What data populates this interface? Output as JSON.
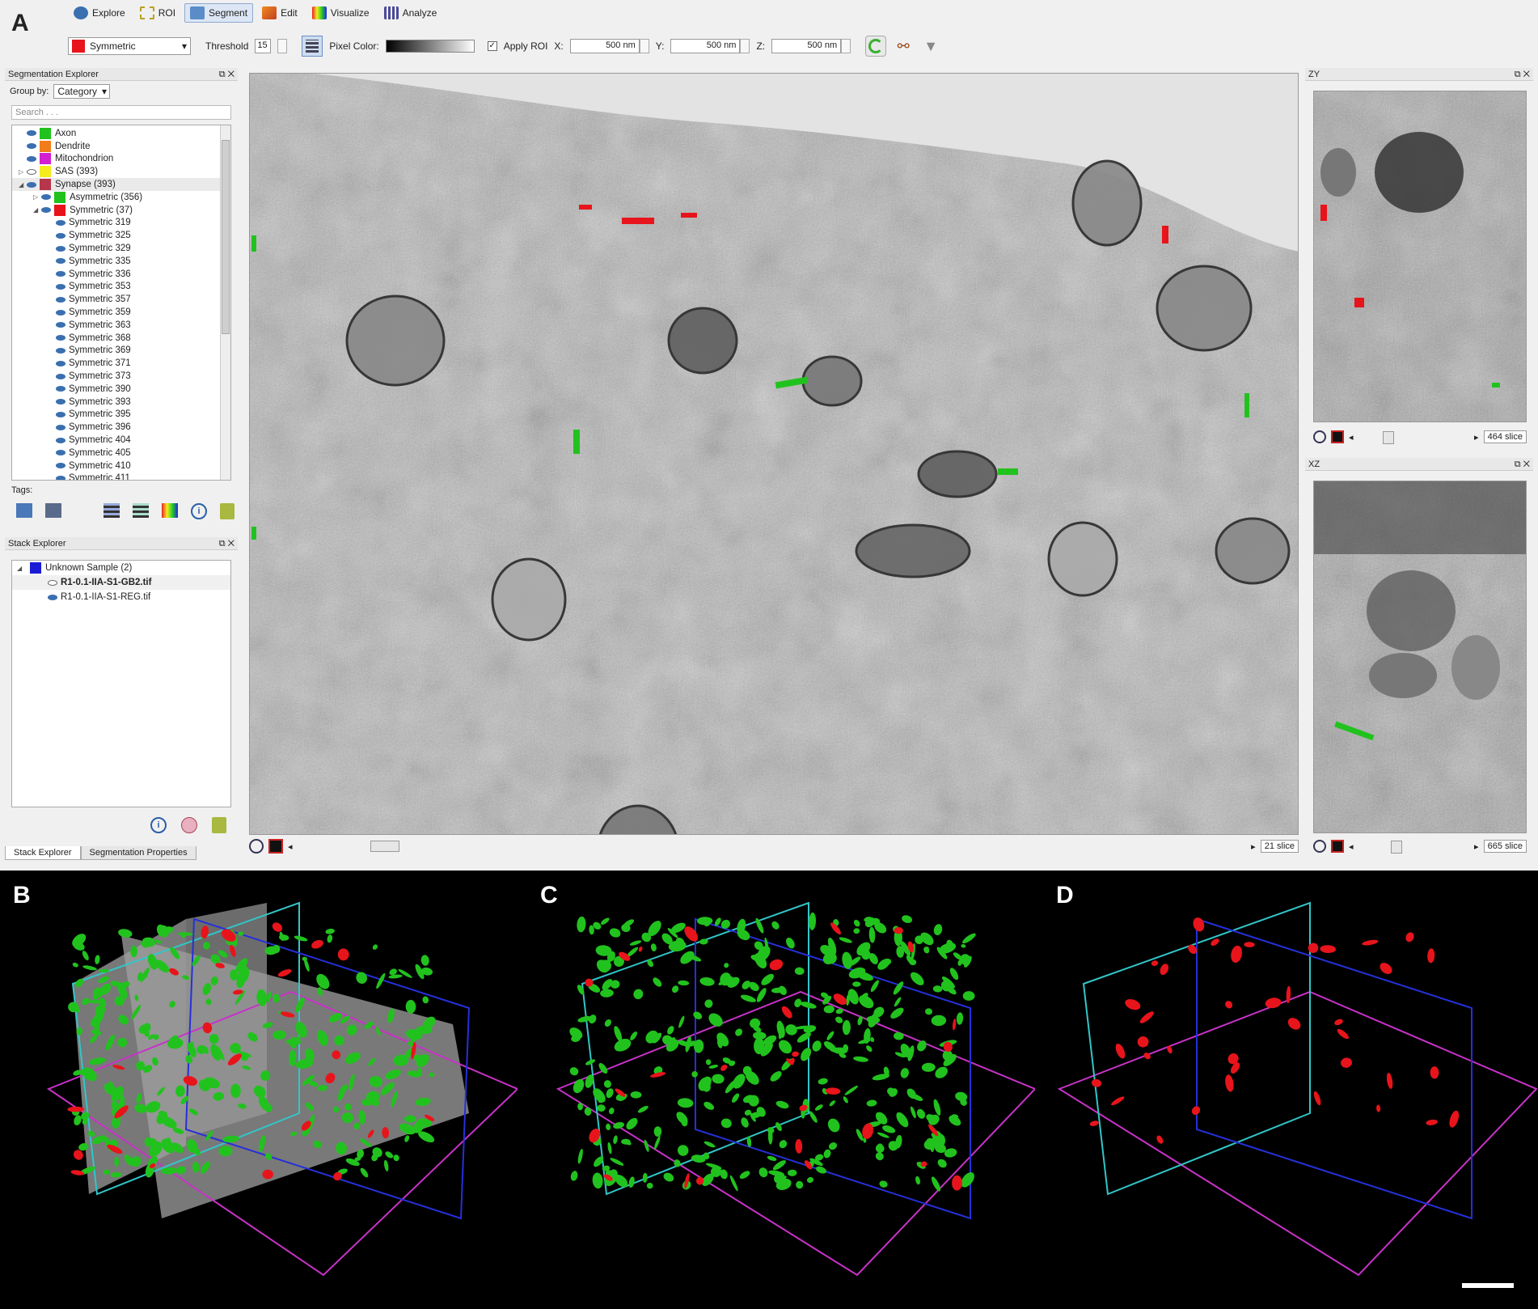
{
  "panels": {
    "a": "A",
    "b": "B",
    "c": "C",
    "d": "D"
  },
  "modes": [
    {
      "label": "Explore",
      "active": false
    },
    {
      "label": "ROI",
      "active": false
    },
    {
      "label": "Segment",
      "active": true
    },
    {
      "label": "Edit",
      "active": false
    },
    {
      "label": "Visualize",
      "active": false
    },
    {
      "label": "Analyze",
      "active": false
    }
  ],
  "toolbar": {
    "category_value": "Symmetric",
    "category_color": "#e8141b",
    "threshold_label": "Threshold",
    "threshold_value": "15",
    "pixel_color_label": "Pixel Color:",
    "apply_roi_label": "Apply ROI",
    "x_label": "X:",
    "x_value": "500 nm",
    "y_label": "Y:",
    "y_value": "500 nm",
    "z_label": "Z:",
    "z_value": "500 nm"
  },
  "seg_explorer": {
    "title": "Segmentation Explorer",
    "group_by_label": "Group by:",
    "group_by_value": "Category",
    "search_placeholder": "Search . . .",
    "items": [
      {
        "label": "Axon",
        "color": "#22c21e",
        "level": 0,
        "expander": ""
      },
      {
        "label": "Dendrite",
        "color": "#f07d1a",
        "level": 0,
        "expander": ""
      },
      {
        "label": "Mitochondrion",
        "color": "#d11fd1",
        "level": 0,
        "expander": ""
      },
      {
        "label": "SAS (393)",
        "color": "#f4ec1c",
        "level": 0,
        "expander": "▷"
      },
      {
        "label": "Synapse (393)",
        "color": "#b8364a",
        "level": 0,
        "expander": "◢"
      },
      {
        "label": "Asymmetric (356)",
        "color": "#22c21e",
        "level": 1,
        "expander": "▷"
      },
      {
        "label": "Symmetric (37)",
        "color": "#e8141b",
        "level": 1,
        "expander": "◢"
      },
      {
        "label": "Symmetric 319",
        "level": 2
      },
      {
        "label": "Symmetric 325",
        "level": 2
      },
      {
        "label": "Symmetric 329",
        "level": 2
      },
      {
        "label": "Symmetric 335",
        "level": 2
      },
      {
        "label": "Symmetric 336",
        "level": 2
      },
      {
        "label": "Symmetric 353",
        "level": 2
      },
      {
        "label": "Symmetric 357",
        "level": 2
      },
      {
        "label": "Symmetric 359",
        "level": 2
      },
      {
        "label": "Symmetric 363",
        "level": 2
      },
      {
        "label": "Symmetric 368",
        "level": 2
      },
      {
        "label": "Symmetric 369",
        "level": 2
      },
      {
        "label": "Symmetric 371",
        "level": 2
      },
      {
        "label": "Symmetric 373",
        "level": 2
      },
      {
        "label": "Symmetric 390",
        "level": 2
      },
      {
        "label": "Symmetric 393",
        "level": 2
      },
      {
        "label": "Symmetric 395",
        "level": 2
      },
      {
        "label": "Symmetric 396",
        "level": 2
      },
      {
        "label": "Symmetric 404",
        "level": 2
      },
      {
        "label": "Symmetric 405",
        "level": 2
      },
      {
        "label": "Symmetric 410",
        "level": 2
      },
      {
        "label": "Symmetric 411",
        "level": 2
      }
    ],
    "tags_label": "Tags:"
  },
  "stack_explorer": {
    "title": "Stack Explorer",
    "sample_label": "Unknown Sample (2)",
    "sample_color": "#1b1bd6",
    "files": [
      "R1-0.1-IIA-S1-GB2.tif",
      "R1-0.1-IIA-S1-REG.tif"
    ]
  },
  "bottom_tabs": [
    "Stack Explorer",
    "Segmentation Properties"
  ],
  "views": {
    "main_slice": "21 slice",
    "zy_title": "ZY",
    "zy_slice": "464 slice",
    "xz_title": "XZ",
    "xz_slice": "665 slice"
  },
  "colors": {
    "asymmetric": "#22c21e",
    "symmetric": "#e8141b",
    "plane_zy": "#32c6c8",
    "plane_xz": "#2630d8",
    "plane_xy": "#c832c8"
  }
}
